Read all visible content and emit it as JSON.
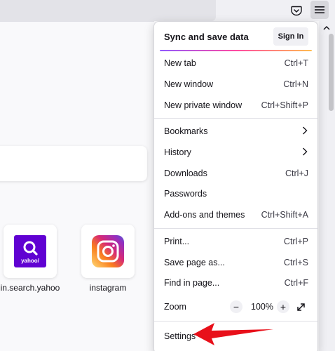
{
  "toolbar": {
    "pocket_icon": "pocket-icon",
    "menu_icon": "hamburger-menu-icon"
  },
  "tiles": [
    {
      "label": "in.search.yahoo",
      "icon": "yahoo-search-icon",
      "logo_text": "yahoo/",
      "color": "#6001d2"
    },
    {
      "label": "instagram",
      "icon": "instagram-icon"
    }
  ],
  "menu": {
    "header_title": "Sync and save data",
    "sign_in_label": "Sign In",
    "items": [
      {
        "label": "New tab",
        "shortcut": "Ctrl+T"
      },
      {
        "label": "New window",
        "shortcut": "Ctrl+N"
      },
      {
        "label": "New private window",
        "shortcut": "Ctrl+Shift+P"
      },
      {
        "label": "Bookmarks",
        "shortcut": ""
      },
      {
        "label": "History",
        "shortcut": ""
      },
      {
        "label": "Downloads",
        "shortcut": "Ctrl+J"
      },
      {
        "label": "Passwords",
        "shortcut": ""
      },
      {
        "label": "Add-ons and themes",
        "shortcut": "Ctrl+Shift+A"
      },
      {
        "label": "Print...",
        "shortcut": "Ctrl+P"
      },
      {
        "label": "Save page as...",
        "shortcut": "Ctrl+S"
      },
      {
        "label": "Find in page...",
        "shortcut": "Ctrl+F"
      }
    ],
    "zoom": {
      "label": "Zoom",
      "minus": "−",
      "level": "100%",
      "plus": "+"
    },
    "settings_label": "Settings"
  },
  "colors": {
    "annotation_arrow": "#e8101a",
    "accent_start": "#9059ff",
    "accent_end": "#ffbd4f"
  }
}
